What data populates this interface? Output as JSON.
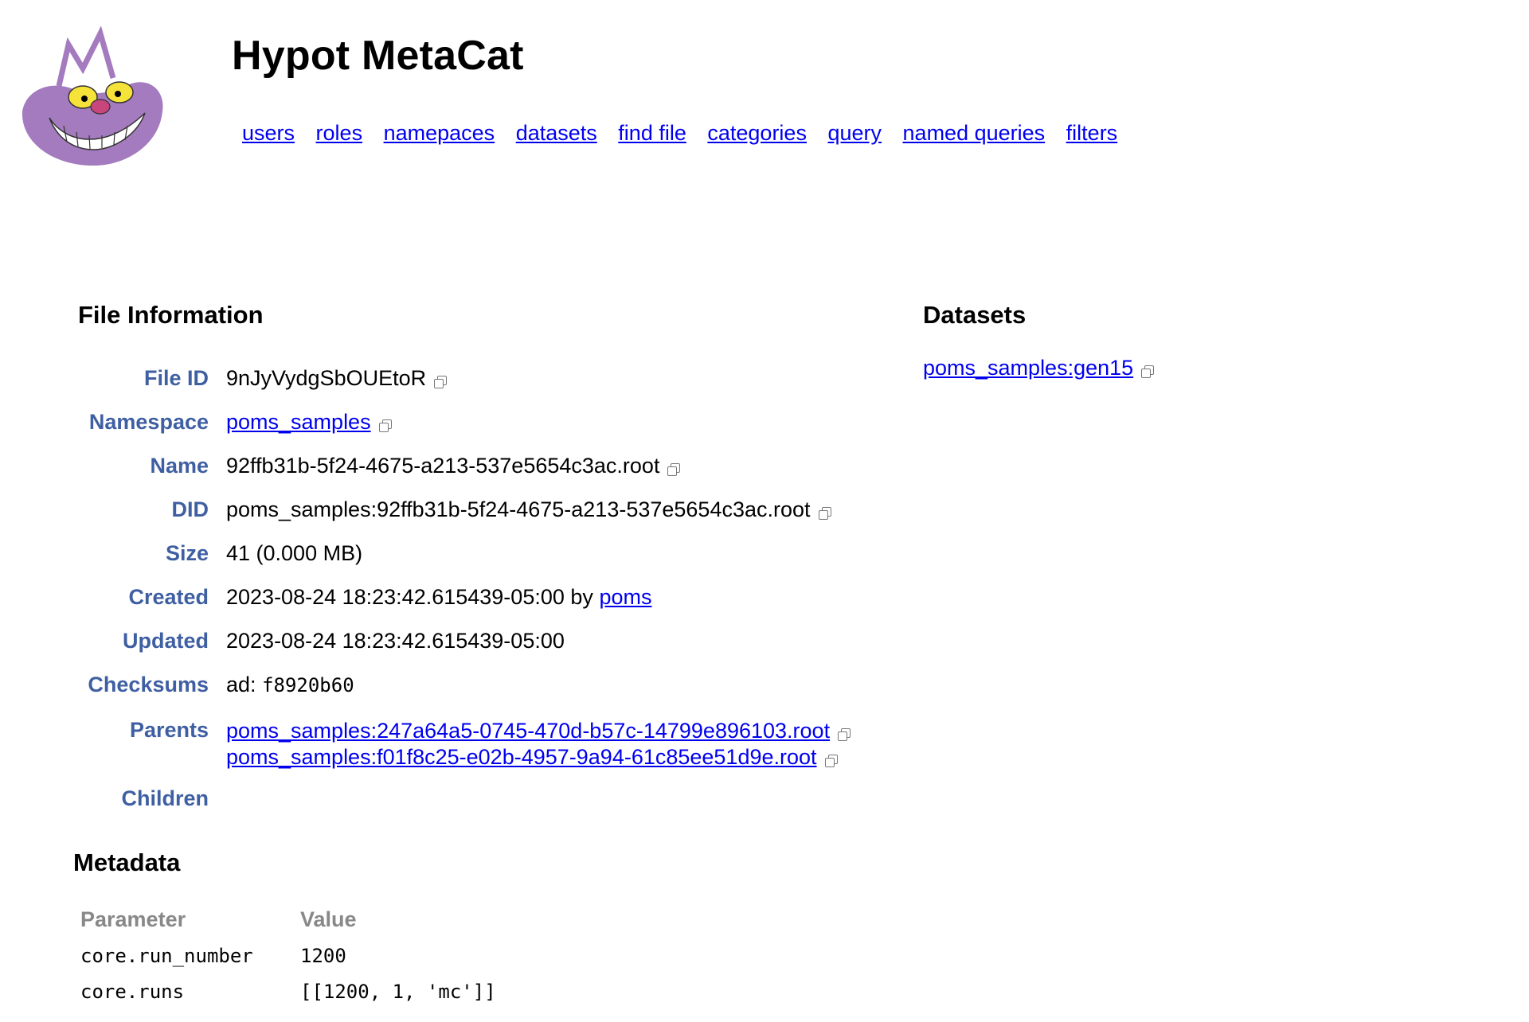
{
  "app": {
    "title": "Hypot MetaCat",
    "logo_icon": "cheshire-cat-logo"
  },
  "nav": {
    "items": [
      "users",
      "roles",
      "namepaces",
      "datasets",
      "find file",
      "categories",
      "query",
      "named queries",
      "filters"
    ]
  },
  "file_info": {
    "title": "File Information",
    "rows": {
      "file_id": {
        "label": "File ID",
        "value": "9nJyVydgSbOUEtoR"
      },
      "namespace": {
        "label": "Namespace",
        "value": "poms_samples"
      },
      "name": {
        "label": "Name",
        "value": "92ffb31b-5f24-4675-a213-537e5654c3ac.root"
      },
      "did": {
        "label": "DID",
        "value": "poms_samples:92ffb31b-5f24-4675-a213-537e5654c3ac.root"
      },
      "size": {
        "label": "Size",
        "value": "41 (0.000 MB)"
      },
      "created": {
        "label": "Created",
        "value": "2023-08-24 18:23:42.615439-05:00",
        "by_text": "by",
        "by_user": "poms"
      },
      "updated": {
        "label": "Updated",
        "value": "2023-08-24 18:23:42.615439-05:00"
      },
      "checksums": {
        "label": "Checksums",
        "type": "ad:",
        "value": "f8920b60"
      },
      "parents": {
        "label": "Parents",
        "items": [
          "poms_samples:247a64a5-0745-470d-b57c-14799e896103.root",
          "poms_samples:f01f8c25-e02b-4957-9a94-61c85ee51d9e.root"
        ]
      },
      "children": {
        "label": "Children"
      }
    }
  },
  "datasets": {
    "title": "Datasets",
    "items": [
      "poms_samples:gen15"
    ]
  },
  "metadata": {
    "title": "Metadata",
    "headers": {
      "parameter": "Parameter",
      "value": "Value"
    },
    "rows": [
      {
        "parameter": "core.run_number",
        "value": "1200"
      },
      {
        "parameter": "core.runs",
        "value": "[[1200, 1, 'mc']]"
      }
    ]
  },
  "colors": {
    "label": "#3f5fa3",
    "link": "#0000ee",
    "logo_body": "#a57bbf",
    "logo_eye": "#f5e33a"
  }
}
